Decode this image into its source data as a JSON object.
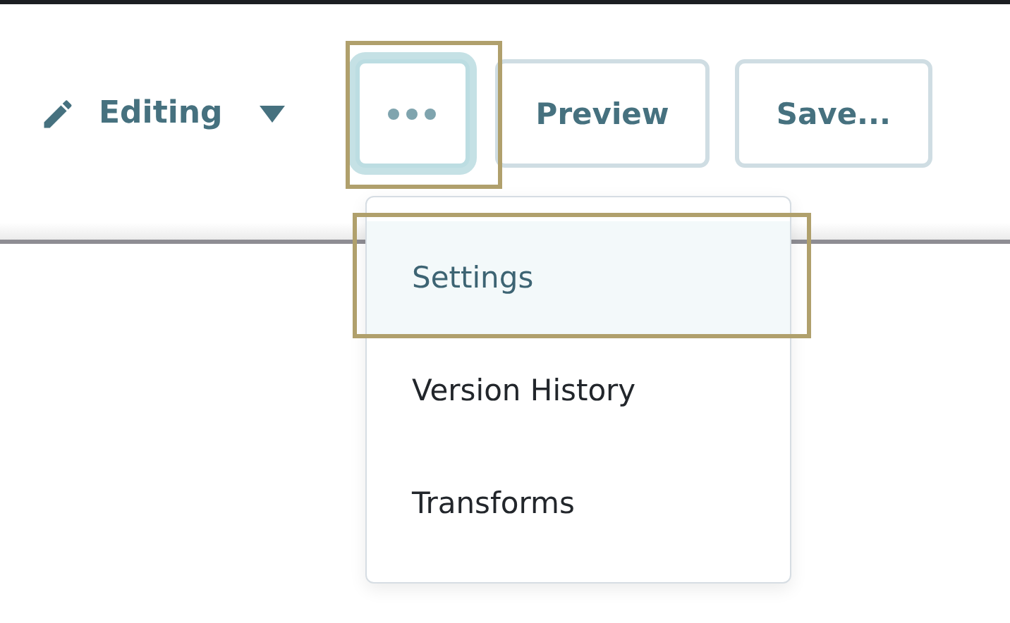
{
  "toolbar": {
    "mode": {
      "label": "Editing"
    },
    "more_button": {
      "highlighted": true,
      "focused": true
    },
    "buttons": [
      "Preview",
      "Save..."
    ]
  },
  "menu": {
    "items": [
      {
        "label": "Settings",
        "selected": true,
        "highlighted": true
      },
      {
        "label": "Version History",
        "selected": false,
        "highlighted": false
      },
      {
        "label": "Transforms",
        "selected": false,
        "highlighted": false
      }
    ]
  }
}
